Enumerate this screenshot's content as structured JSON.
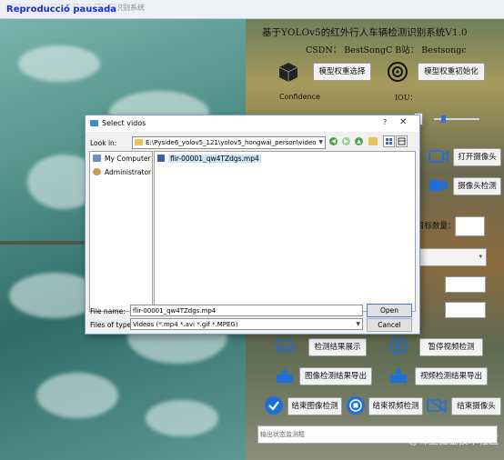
{
  "window": {
    "title": "基于YOLOv5的红外行人车辆检测识别系统",
    "overlay_label": "Reproducció pausada"
  },
  "panel": {
    "heading": "基于YOLOv5的红外行人车辆检测识别系统V1.0",
    "subheading": "CSDN： BestSongC  B站： Bestsongc",
    "select_weights": "模型权重选择",
    "init_weights": "模型权重初始化",
    "confidence_label": "Confidence",
    "iou_label": "IOU：",
    "open_camera": "打开摄像头",
    "camera_detect": "摄像头检测",
    "target_count_label": "目标数量：",
    "show_results": "检测结果展示",
    "pause_video": "暂停视频检测",
    "export_image_results": "图像检测结果导出",
    "export_video_results": "视频检测结果导出",
    "end_image_detect": "结束图像检测",
    "end_video_detect": "结束视频检测",
    "end_camera": "结束摄像头",
    "status": "输出状态监测框",
    "watermark": "@稀土掘金技术社区"
  },
  "dialog": {
    "title": "Select vidos",
    "help": "?",
    "close": "✕",
    "look_in_label": "Look in:",
    "look_in_path": "E:\\Pyside6_yolov5_121\\yolov5_hongwai_person\\video",
    "sidebar": [
      "My Computer",
      "Administrator"
    ],
    "files": [
      "flir-00001_qw4TZdgs.mp4"
    ],
    "file_name_label": "File name:",
    "file_name_value": "flir-00001_qw4TZdgs.mp4",
    "file_type_label": "Files of type:",
    "file_type_value": "Videos (*.mp4 *.avi *.gif *.MPEG)",
    "open_button": "Open",
    "cancel_button": "Cancel"
  },
  "icons": [
    "app-icon",
    "cube-icon",
    "target-icon",
    "camera-icon",
    "video-icon",
    "image-export-icon",
    "pause-icon",
    "play-icon",
    "check-icon",
    "stop-icon",
    "folder-icon",
    "computer-icon",
    "user-icon",
    "file-icon",
    "back-icon",
    "up-icon",
    "new-folder-icon",
    "list-view-icon",
    "detail-view-icon"
  ],
  "colors": {
    "accent": "#1a2fb8",
    "blue_icon": "#1e6fd8",
    "selection": "#cde3f7"
  }
}
